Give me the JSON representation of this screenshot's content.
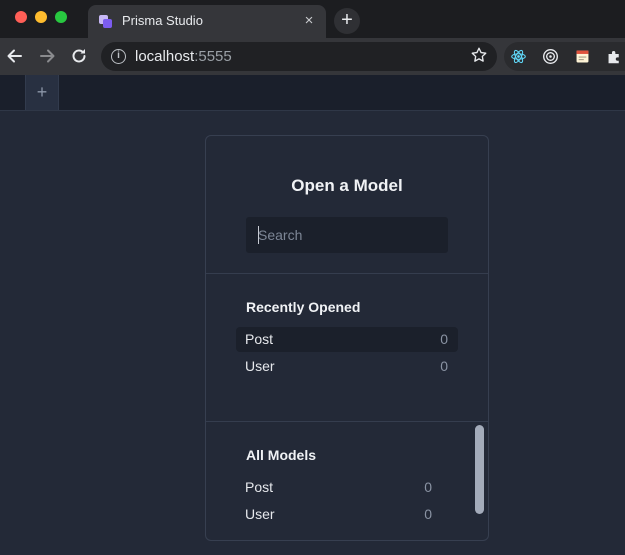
{
  "browser": {
    "tab_title": "Prisma Studio",
    "close_glyph": "×",
    "new_tab_glyph": "+",
    "url_host": "localhost",
    "url_port": ":5555",
    "icons": [
      "back-arrow-icon",
      "forward-arrow-icon",
      "reload-icon",
      "info-icon",
      "star-icon",
      "react-devtools-icon",
      "target-icon",
      "notes-icon",
      "puzzle-icon"
    ]
  },
  "app": {
    "add_tab_glyph": "+",
    "title": "Open a Model",
    "search": {
      "placeholder": "Search",
      "value": ""
    },
    "recent": {
      "title": "Recently Opened",
      "items": [
        {
          "name": "Post",
          "count": "0",
          "selected": true
        },
        {
          "name": "User",
          "count": "0",
          "selected": false
        }
      ]
    },
    "all_models": {
      "title": "All Models",
      "items": [
        {
          "name": "Post",
          "count": "0"
        },
        {
          "name": "User",
          "count": "0"
        }
      ]
    }
  },
  "colors": {
    "background": "#232937",
    "panel_border": "#373f50",
    "selected_row": "#1b202b",
    "scrollbar": "#a3abba"
  }
}
